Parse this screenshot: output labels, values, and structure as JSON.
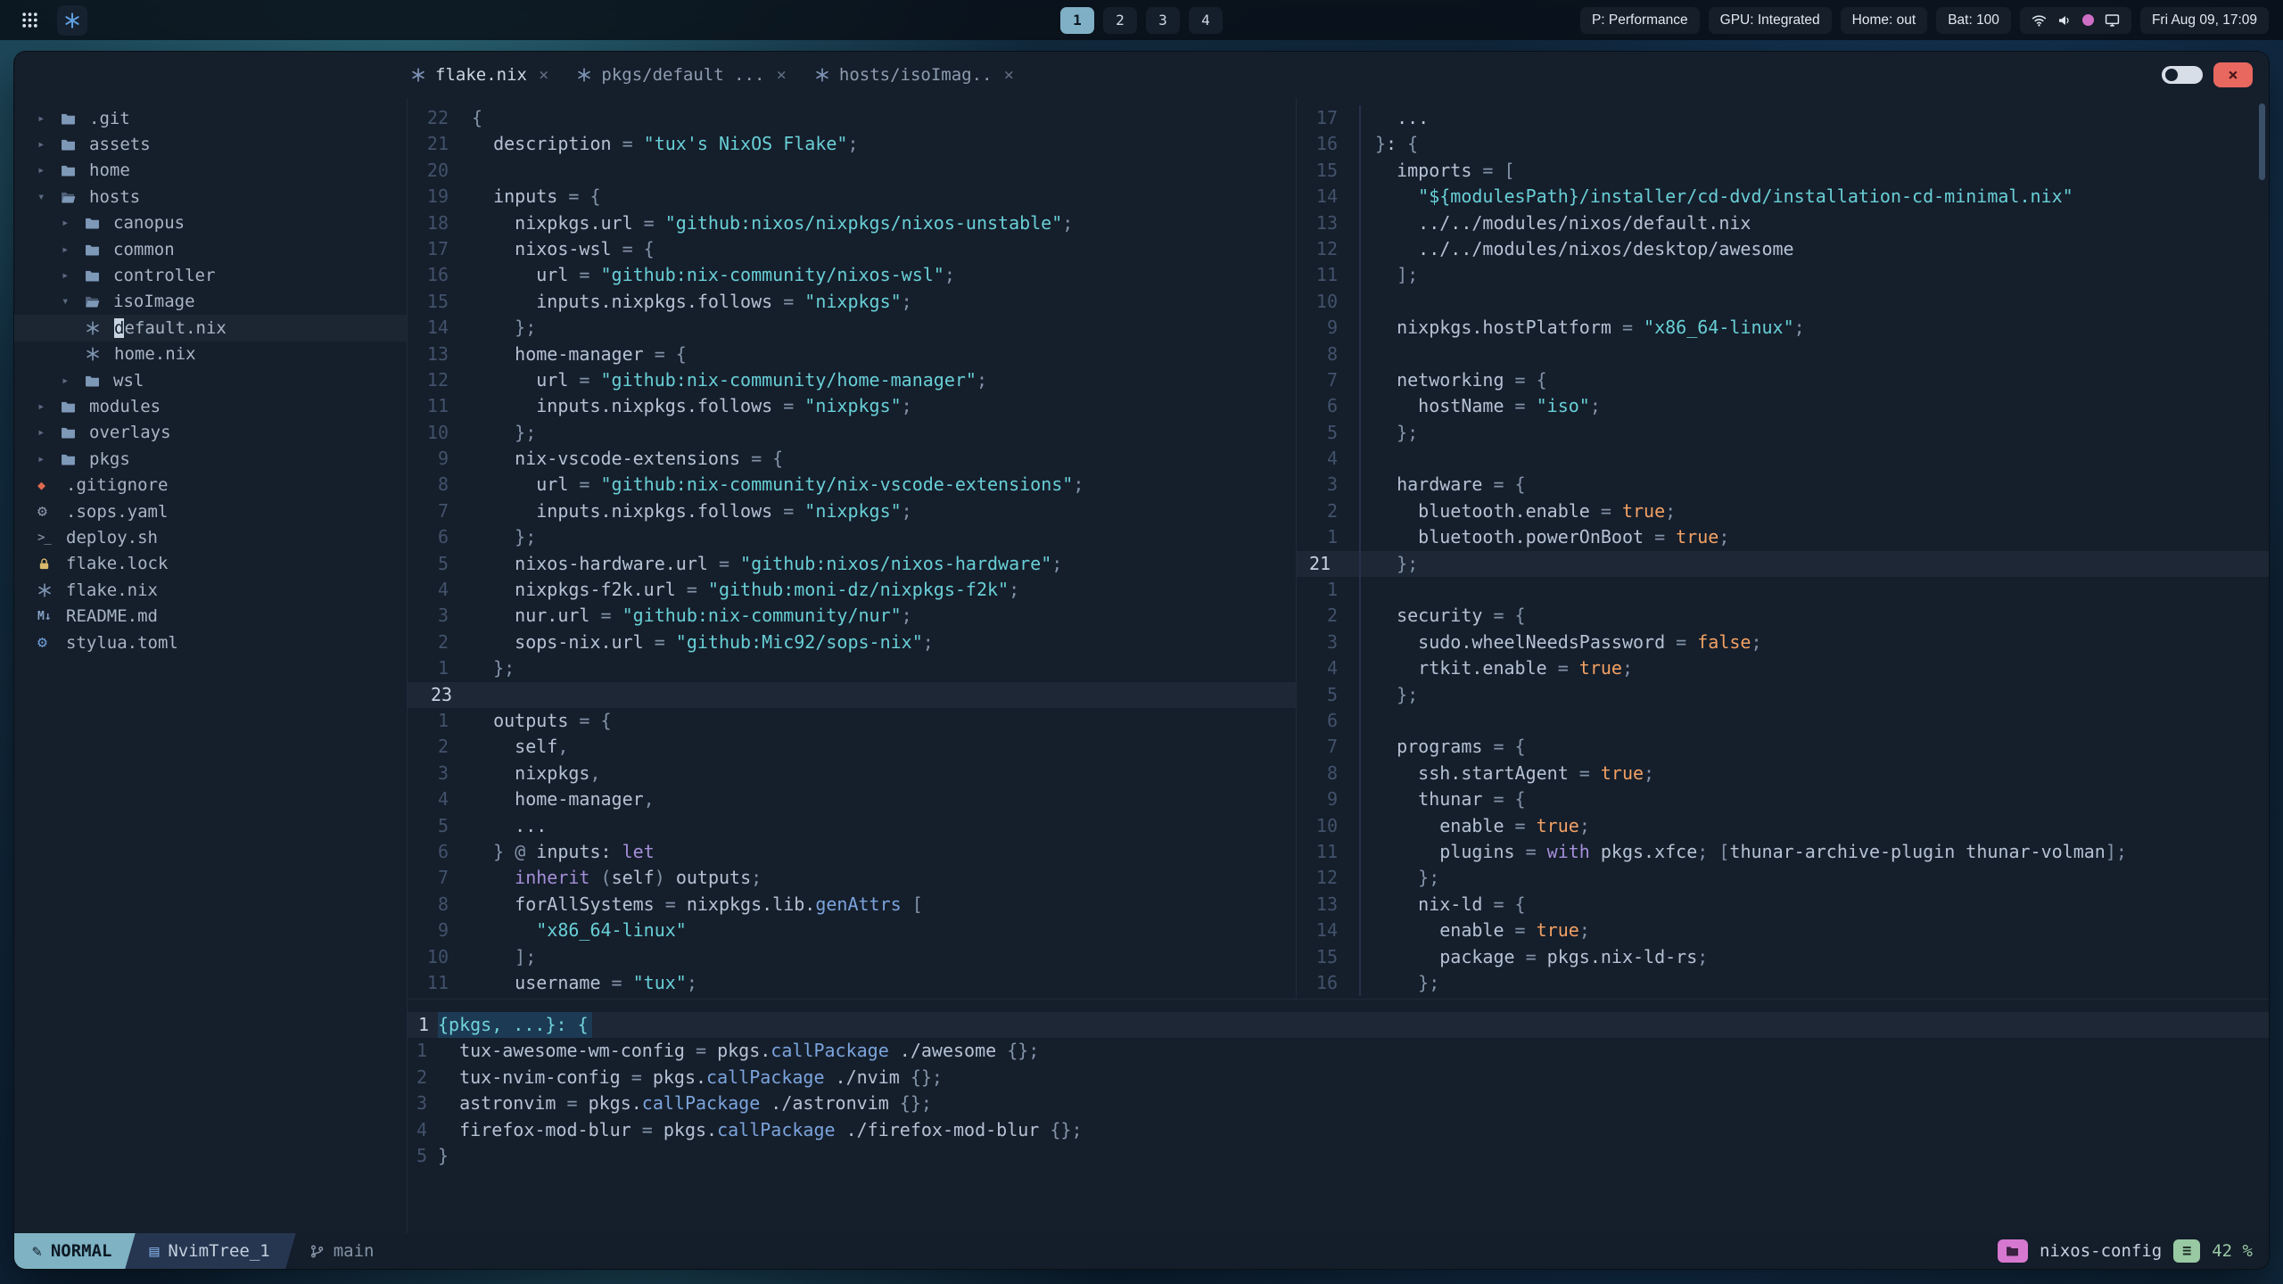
{
  "topbar": {
    "workspaces": [
      {
        "label": "1",
        "active": true
      },
      {
        "label": "2",
        "active": false
      },
      {
        "label": "3",
        "active": false
      },
      {
        "label": "4",
        "active": false
      }
    ],
    "status_pills": [
      "P: Performance",
      "GPU: Integrated",
      "Home: out",
      "Bat: 100"
    ],
    "tray_icons": [
      "wifi-icon",
      "volume-icon",
      "indicator-dot",
      "display-icon"
    ],
    "clock": "Fri Aug 09, 17:09"
  },
  "window": {
    "tabs": [
      {
        "label": "flake.nix",
        "active": true
      },
      {
        "label": "pkgs/default ...",
        "active": false
      },
      {
        "label": "hosts/isoImag..",
        "active": false
      }
    ],
    "controls": {
      "close_label": "×"
    },
    "tree": [
      {
        "type": "dir",
        "depth": 0,
        "expanded": false,
        "label": ".git"
      },
      {
        "type": "dir",
        "depth": 0,
        "expanded": false,
        "label": "assets"
      },
      {
        "type": "dir",
        "depth": 0,
        "expanded": false,
        "label": "home"
      },
      {
        "type": "dir",
        "depth": 0,
        "expanded": true,
        "label": "hosts"
      },
      {
        "type": "dir",
        "depth": 1,
        "expanded": false,
        "label": "canopus"
      },
      {
        "type": "dir",
        "depth": 1,
        "expanded": false,
        "label": "common"
      },
      {
        "type": "dir",
        "depth": 1,
        "expanded": false,
        "label": "controller"
      },
      {
        "type": "dir",
        "depth": 1,
        "expanded": true,
        "label": "isoImage"
      },
      {
        "type": "file",
        "icon": "nix",
        "depth": 2,
        "label": "default.nix",
        "cursor": true
      },
      {
        "type": "file",
        "icon": "nix",
        "depth": 2,
        "label": "home.nix"
      },
      {
        "type": "dir",
        "depth": 1,
        "expanded": false,
        "label": "wsl"
      },
      {
        "type": "dir",
        "depth": 0,
        "expanded": false,
        "label": "modules"
      },
      {
        "type": "dir",
        "depth": 0,
        "expanded": false,
        "label": "overlays"
      },
      {
        "type": "dir",
        "depth": 0,
        "expanded": false,
        "label": "pkgs"
      },
      {
        "type": "file",
        "icon": "git",
        "depth": 0,
        "label": ".gitignore"
      },
      {
        "type": "file",
        "icon": "gear",
        "depth": 0,
        "label": ".sops.yaml"
      },
      {
        "type": "file",
        "icon": "shell",
        "depth": 0,
        "label": "deploy.sh"
      },
      {
        "type": "file",
        "icon": "lock",
        "depth": 0,
        "label": "flake.lock"
      },
      {
        "type": "file",
        "icon": "nix",
        "depth": 0,
        "label": "flake.nix"
      },
      {
        "type": "file",
        "icon": "markdown",
        "depth": 0,
        "label": "README.md"
      },
      {
        "type": "file",
        "icon": "gear2",
        "depth": 0,
        "label": "stylua.toml"
      }
    ],
    "editors": {
      "flake": {
        "lines": [
          {
            "n": "22",
            "t": "{"
          },
          {
            "n": "21",
            "t": "  description = \"tux's NixOS Flake\";"
          },
          {
            "n": "20",
            "t": ""
          },
          {
            "n": "19",
            "t": "  inputs = {"
          },
          {
            "n": "18",
            "t": "    nixpkgs.url = \"github:nixos/nixpkgs/nixos-unstable\";"
          },
          {
            "n": "17",
            "t": "    nixos-wsl = {"
          },
          {
            "n": "16",
            "t": "      url = \"github:nix-community/nixos-wsl\";"
          },
          {
            "n": "15",
            "t": "      inputs.nixpkgs.follows = \"nixpkgs\";"
          },
          {
            "n": "14",
            "t": "    };"
          },
          {
            "n": "13",
            "t": "    home-manager = {"
          },
          {
            "n": "12",
            "t": "      url = \"github:nix-community/home-manager\";"
          },
          {
            "n": "11",
            "t": "      inputs.nixpkgs.follows = \"nixpkgs\";"
          },
          {
            "n": "10",
            "t": "    };"
          },
          {
            "n": "9",
            "t": "    nix-vscode-extensions = {"
          },
          {
            "n": "8",
            "t": "      url = \"github:nix-community/nix-vscode-extensions\";"
          },
          {
            "n": "7",
            "t": "      inputs.nixpkgs.follows = \"nixpkgs\";"
          },
          {
            "n": "6",
            "t": "    };"
          },
          {
            "n": "5",
            "t": "    nixos-hardware.url = \"github:nixos/nixos-hardware\";"
          },
          {
            "n": "4",
            "t": "    nixpkgs-f2k.url = \"github:moni-dz/nixpkgs-f2k\";"
          },
          {
            "n": "3",
            "t": "    nur.url = \"github:nix-community/nur\";"
          },
          {
            "n": "2",
            "t": "    sops-nix.url = \"github:Mic92/sops-nix\";"
          },
          {
            "n": "1",
            "t": "  };"
          },
          {
            "n": "23",
            "t": "",
            "cur": true
          },
          {
            "n": "1",
            "t": "  outputs = {"
          },
          {
            "n": "2",
            "t": "    self,"
          },
          {
            "n": "3",
            "t": "    nixpkgs,"
          },
          {
            "n": "4",
            "t": "    home-manager,"
          },
          {
            "n": "5",
            "t": "    ..."
          },
          {
            "n": "6",
            "t": "  } @ inputs: let"
          },
          {
            "n": "7",
            "t": "    inherit (self) outputs;"
          },
          {
            "n": "8",
            "t": "    forAllSystems = nixpkgs.lib.genAttrs ["
          },
          {
            "n": "9",
            "t": "      \"x86_64-linux\""
          },
          {
            "n": "10",
            "t": "    ];"
          },
          {
            "n": "11",
            "t": "    username = \"tux\";"
          }
        ]
      },
      "iso": {
        "lines": [
          {
            "n": "17",
            "t": "  ..."
          },
          {
            "n": "16",
            "t": "}: {"
          },
          {
            "n": "15",
            "t": "  imports = ["
          },
          {
            "n": "14",
            "t": "    \"${modulesPath}/installer/cd-dvd/installation-cd-minimal.nix\""
          },
          {
            "n": "13",
            "t": "    ../../modules/nixos/default.nix"
          },
          {
            "n": "12",
            "t": "    ../../modules/nixos/desktop/awesome"
          },
          {
            "n": "11",
            "t": "  ];"
          },
          {
            "n": "10",
            "t": ""
          },
          {
            "n": "9",
            "t": "  nixpkgs.hostPlatform = \"x86_64-linux\";"
          },
          {
            "n": "8",
            "t": ""
          },
          {
            "n": "7",
            "t": "  networking = {"
          },
          {
            "n": "6",
            "t": "    hostName = \"iso\";"
          },
          {
            "n": "5",
            "t": "  };"
          },
          {
            "n": "4",
            "t": ""
          },
          {
            "n": "3",
            "t": "  hardware = {"
          },
          {
            "n": "2",
            "t": "    bluetooth.enable = true;"
          },
          {
            "n": "1",
            "t": "    bluetooth.powerOnBoot = true;"
          },
          {
            "n": "21",
            "t": "  };",
            "cur": true
          },
          {
            "n": "1",
            "t": ""
          },
          {
            "n": "2",
            "t": "  security = {"
          },
          {
            "n": "3",
            "t": "    sudo.wheelNeedsPassword = false;"
          },
          {
            "n": "4",
            "t": "    rtkit.enable = true;"
          },
          {
            "n": "5",
            "t": "  };"
          },
          {
            "n": "6",
            "t": ""
          },
          {
            "n": "7",
            "t": "  programs = {"
          },
          {
            "n": "8",
            "t": "    ssh.startAgent = true;"
          },
          {
            "n": "9",
            "t": "    thunar = {"
          },
          {
            "n": "10",
            "t": "      enable = true;"
          },
          {
            "n": "11",
            "t": "      plugins = with pkgs.xfce; [thunar-archive-plugin thunar-volman];"
          },
          {
            "n": "12",
            "t": "    };"
          },
          {
            "n": "13",
            "t": "    nix-ld = {"
          },
          {
            "n": "14",
            "t": "      enable = true;"
          },
          {
            "n": "15",
            "t": "      package = pkgs.nix-ld-rs;"
          },
          {
            "n": "16",
            "t": "    };"
          }
        ]
      },
      "pkgs": {
        "lines": [
          {
            "n": "1",
            "t": "{pkgs, ...}: {",
            "cur": true,
            "hl": "param"
          },
          {
            "n": "1",
            "t": "  tux-awesome-wm-config = pkgs.callPackage ./awesome {};"
          },
          {
            "n": "2",
            "t": "  tux-nvim-config = pkgs.callPackage ./nvim {};"
          },
          {
            "n": "3",
            "t": "  astronvim = pkgs.callPackage ./astronvim {};"
          },
          {
            "n": "4",
            "t": "  firefox-mod-blur = pkgs.callPackage ./firefox-mod-blur {};"
          },
          {
            "n": "5",
            "t": "}"
          }
        ]
      }
    },
    "statusline": {
      "mode": "NORMAL",
      "buffer": "NvimTree_1",
      "branch": "main",
      "project": "nixos-config",
      "scroll": "42 %"
    }
  }
}
